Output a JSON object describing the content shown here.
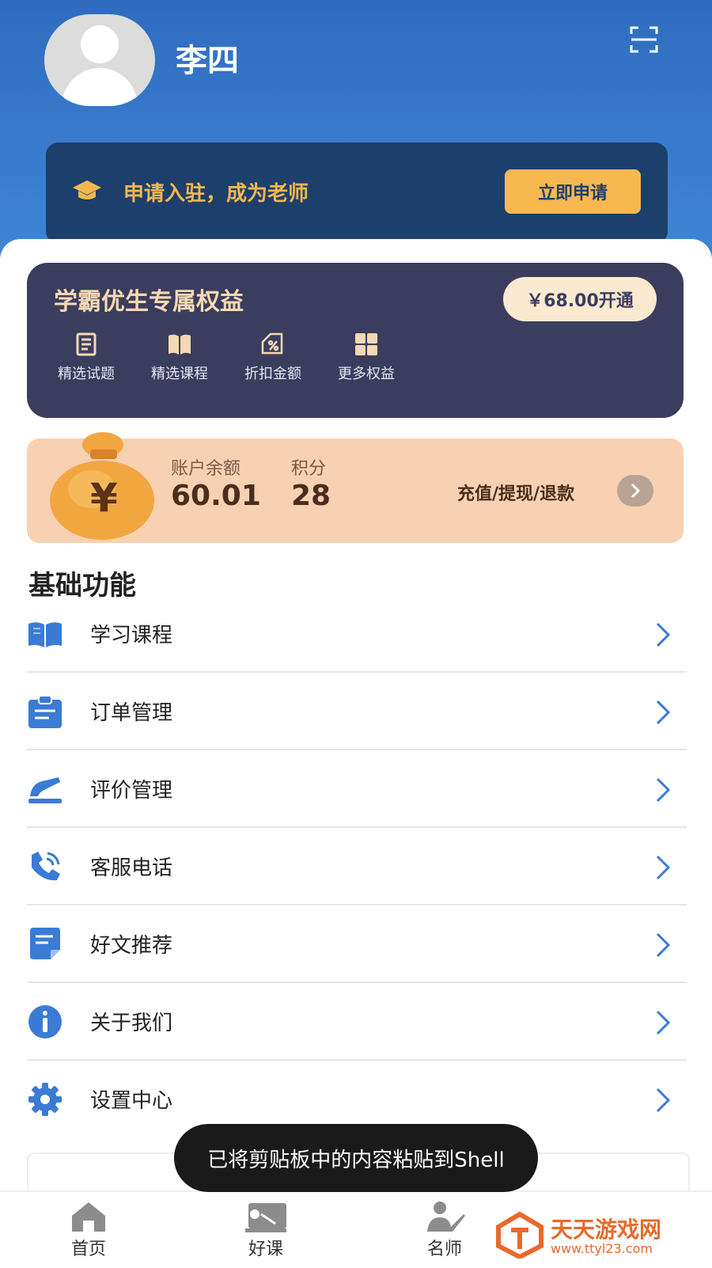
{
  "header": {
    "username": "李四",
    "scan_icon": "scan-icon"
  },
  "teacher_banner": {
    "label": "申请入驻，成为老师",
    "button": "立即申请"
  },
  "vip_card": {
    "title": "学霸优生专属权益",
    "button": "￥68.00开通",
    "benefits": [
      {
        "label": "精选试题",
        "icon": "exam-list-icon"
      },
      {
        "label": "精选课程",
        "icon": "book-icon"
      },
      {
        "label": "折扣金额",
        "icon": "discount-tag-icon"
      },
      {
        "label": "更多权益",
        "icon": "grid-icon"
      }
    ]
  },
  "wallet": {
    "balance_label": "账户余额",
    "balance_value": "60.01",
    "points_label": "积分",
    "points_value": "28",
    "link": "充值/提现/退款"
  },
  "basic_functions": {
    "title": "基础功能",
    "items": [
      {
        "label": "学习课程",
        "icon": "open-book-icon"
      },
      {
        "label": "订单管理",
        "icon": "clipboard-icon"
      },
      {
        "label": "评价管理",
        "icon": "comment-edit-icon"
      },
      {
        "label": "客服电话",
        "icon": "phone-icon"
      },
      {
        "label": "好文推荐",
        "icon": "article-icon"
      },
      {
        "label": "关于我们",
        "icon": "info-icon"
      },
      {
        "label": "设置中心",
        "icon": "gear-icon"
      }
    ]
  },
  "toast": "已将剪贴板中的内容粘贴到Shell",
  "tabbar": {
    "tabs": [
      {
        "label": "首页",
        "icon": "home-icon"
      },
      {
        "label": "好课",
        "icon": "course-icon"
      },
      {
        "label": "名师",
        "icon": "teacher-icon"
      }
    ]
  },
  "watermark": {
    "title": "天天游戏网",
    "url": "www.ttyl23.com"
  },
  "colors": {
    "header_blue": "#2f6cc0",
    "banner_navy": "#1d3f6c",
    "accent_gold": "#f7b84f",
    "vip_card": "#3b3d5e",
    "wallet_peach": "#f8d1b2",
    "icon_blue": "#3a7bd5",
    "watermark_orange": "#e86a2c"
  }
}
